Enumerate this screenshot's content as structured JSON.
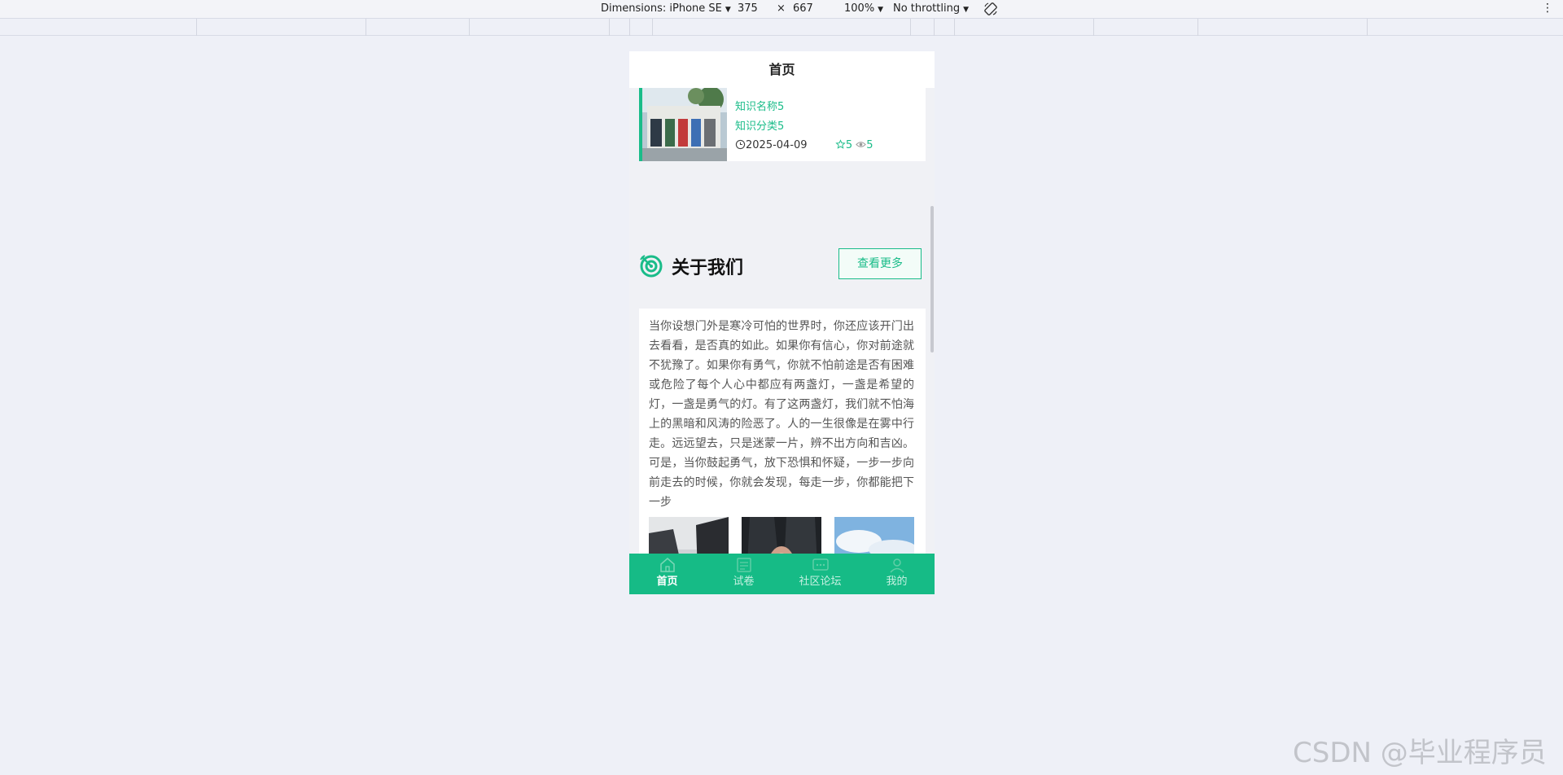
{
  "devtools": {
    "dimensions_label": "Dimensions: iPhone SE",
    "width": "375",
    "times": "×",
    "height": "667",
    "zoom": "100%",
    "throttling": "No throttling",
    "caret": "▼",
    "kebab": "⋮"
  },
  "page": {
    "title": "首页"
  },
  "knowledge": {
    "name": "知识名称5",
    "category": "知识分类5",
    "date": "2025-04-09",
    "likes": "5",
    "views": "5"
  },
  "about": {
    "title": "关于我们",
    "more_label": "查看更多",
    "text": "当你设想门外是寒冷可怕的世界时，你还应该开门出去看看，是否真的如此。如果你有信心，你对前途就不犹豫了。如果你有勇气，你就不怕前途是否有困难或危险了每个人心中都应有两盏灯，一盏是希望的灯，一盏是勇气的灯。有了这两盏灯，我们就不怕海上的黑暗和风涛的险恶了。人的一生很像是在雾中行走。远远望去，只是迷蒙一片，辨不出方向和吉凶。可是，当你鼓起勇气，放下恐惧和怀疑，一步一步向前走去的时候，你就会发现，每走一步，你都能把下一步"
  },
  "tabbar": {
    "items": [
      {
        "label": "首页",
        "icon": "home-icon",
        "active": true
      },
      {
        "label": "试卷",
        "icon": "exam-icon",
        "active": false
      },
      {
        "label": "社区论坛",
        "icon": "forum-icon",
        "active": false
      },
      {
        "label": "我的",
        "icon": "user-icon",
        "active": false
      }
    ]
  },
  "watermark": "CSDN @毕业程序员",
  "colors": {
    "accent": "#16bb86",
    "background": "#eef0f7"
  }
}
